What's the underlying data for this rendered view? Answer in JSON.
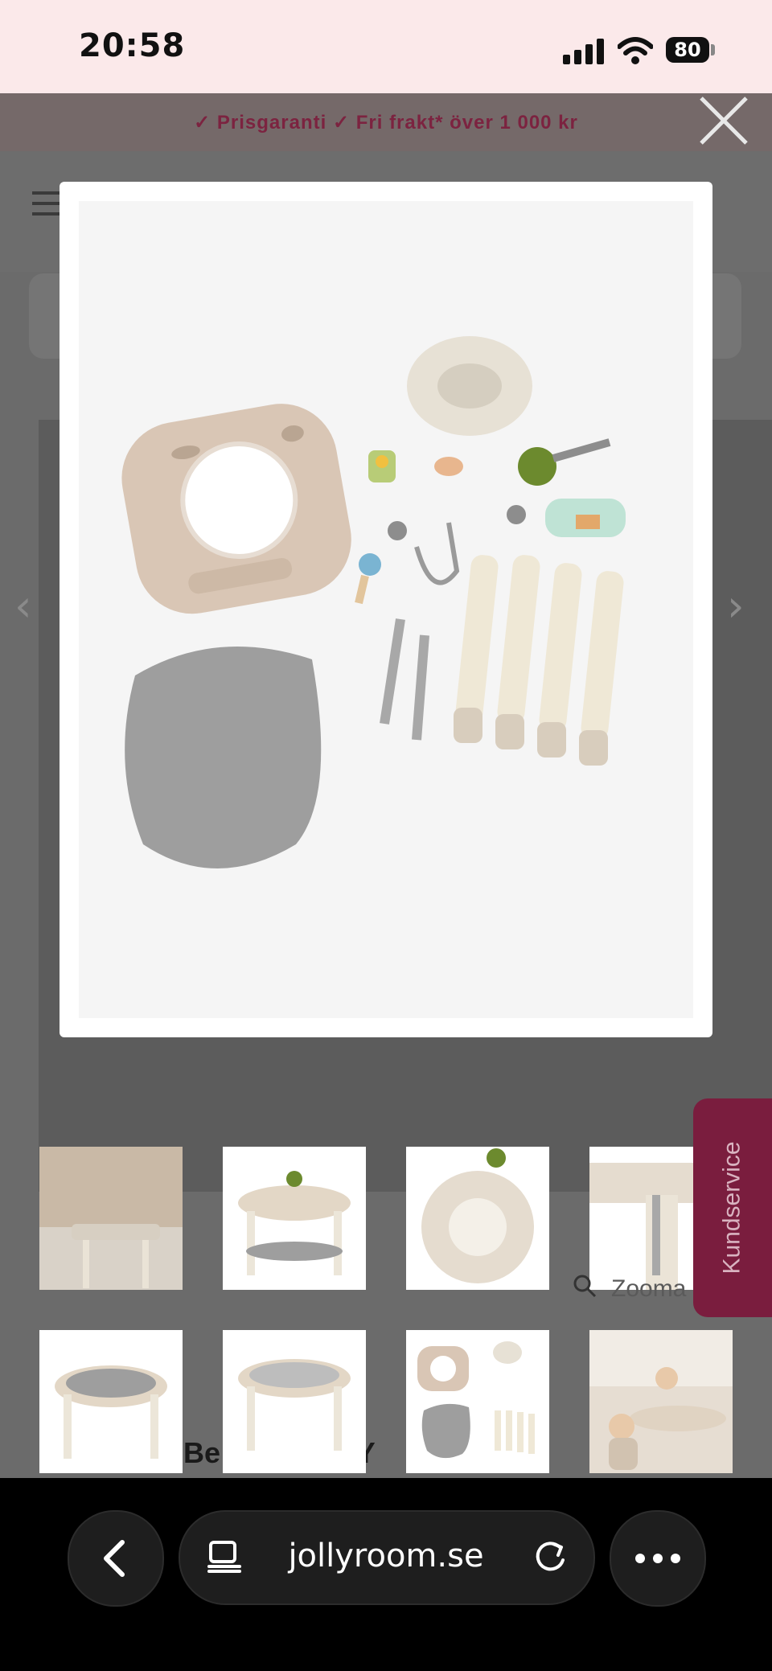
{
  "status_bar": {
    "time": "20:58",
    "battery": "80"
  },
  "promo": {
    "text": "✓ Prisgaranti   ✓ Fri frakt* över 1 000 kr"
  },
  "modal": {
    "image_alt": "Product parts laid out"
  },
  "thumbnails": [
    {
      "id": "thumb-1"
    },
    {
      "id": "thumb-2"
    },
    {
      "id": "thumb-3"
    },
    {
      "id": "thumb-4"
    },
    {
      "id": "thumb-5"
    },
    {
      "id": "thumb-6"
    },
    {
      "id": "thumb-7"
    },
    {
      "id": "thumb-8"
    }
  ],
  "page": {
    "zoom_label": "Zooma",
    "title_fragment_left": "Be",
    "title_fragment_right": "AY"
  },
  "kundservice": {
    "label": "Kundservice"
  },
  "browser": {
    "url": "jollyroom.se"
  },
  "colors": {
    "promo_text": "#7c2340",
    "kundservice_bg": "#7a1d3e",
    "status_bg": "#fbe9ea"
  }
}
